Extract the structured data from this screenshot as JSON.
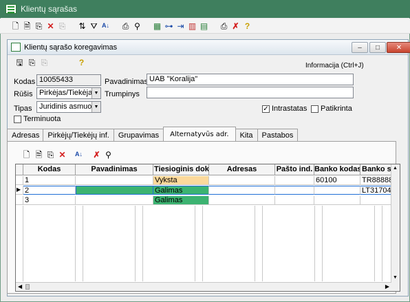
{
  "app": {
    "title": "Klientų sąrašas"
  },
  "dialog": {
    "title": "Klientų sąrašo koregavimas",
    "info": "Informacija (Ctrl+J)"
  },
  "toolbar_icons": [
    "new-icon",
    "document-icon",
    "copy-record-icon",
    "delete-icon",
    "copy-icon",
    "sort-filter-icon",
    "filter-icon",
    "sort-az-icon",
    "print-icon",
    "find-icon",
    "structure-icon",
    "tree-icon",
    "import-icon",
    "calendar-icon",
    "calendar-range-icon",
    "printer-icon",
    "remove-filter-icon",
    "help-icon"
  ],
  "form": {
    "kodas_label": "Kodas",
    "kodas_value": "10055433",
    "pavadinimas_label": "Pavadinimas",
    "pavadinimas_value": "UAB \"Koralija\"",
    "rusis_label": "Rūšis",
    "rusis_value": "Pirkėjas/Tiekėjas",
    "trumpinys_label": "Trumpinys",
    "trumpinys_value": "",
    "tipas_label": "Tipas",
    "tipas_value": "Juridinis asmuo",
    "intrastatas_label": "Intrastatas",
    "intrastatas_checked": true,
    "patikrinta_label": "Patikrinta",
    "patikrinta_checked": false,
    "terminuota_label": "Terminuota",
    "terminuota_checked": false
  },
  "tabs": [
    "Adresas",
    "Pirkėjų/Tiekėjų inf.",
    "Grupavimas",
    "Alternatyvūs adr.",
    "Kita",
    "Pastabos"
  ],
  "active_tab": 3,
  "grid": {
    "columns": [
      "Kodas",
      "Pavadinimas",
      "Tiesioginis dok.ap",
      "Adresas",
      "Pašto ind.",
      "Banko kodas",
      "Banko są"
    ],
    "rows": [
      {
        "kodas": "1",
        "pavadinimas": "",
        "tiesioginis": "Vyksta",
        "adresas": "",
        "pasto": "",
        "banko_kodas": "60100",
        "banko_sas": "TR88888"
      },
      {
        "kodas": "2",
        "pavadinimas": "",
        "tiesioginis": "Galimas",
        "adresas": "",
        "pasto": "",
        "banko_kodas": "",
        "banko_sas": "LT31704"
      },
      {
        "kodas": "3",
        "pavadinimas": "",
        "tiesioginis": "Galimas",
        "adresas": "",
        "pasto": "",
        "banko_kodas": "",
        "banko_sas": ""
      }
    ]
  },
  "colors": {
    "title_green": "#3f7f5e",
    "vyksta": "#fcd99b",
    "galimas": "#3cb371",
    "delete_red": "#d42020"
  }
}
